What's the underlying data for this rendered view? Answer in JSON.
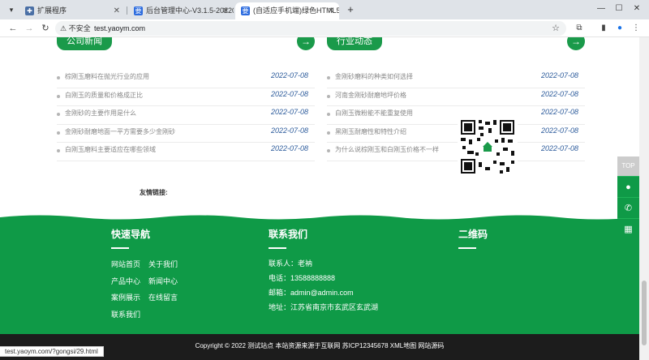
{
  "browser": {
    "tabs": [
      {
        "label": "扩展程序",
        "favicon": "puzzle-icon",
        "active": false
      },
      {
        "label": "后台管理中心-V3.1.5-2022070",
        "favicon": "yao-icon",
        "active": false
      },
      {
        "label": "(自适应手机端)绿色HTML5响应",
        "favicon": "yao-icon",
        "active": true
      }
    ],
    "new_tab": "+",
    "address": {
      "security": "不安全",
      "url": "test.yaoym.com"
    },
    "status_url": "test.yaoym.com/?gongsi/29.html"
  },
  "news": {
    "company": {
      "title": "公司新闻",
      "items": [
        {
          "text": "棕刚玉磨料在抛光行业的应用",
          "date": "2022-07-08"
        },
        {
          "text": "白刚玉的质量和价格成正比",
          "date": "2022-07-08"
        },
        {
          "text": "金刚砂的主要作用是什么",
          "date": "2022-07-08"
        },
        {
          "text": "金刚砂耐磨地面一平方需要多少金刚砂",
          "date": "2022-07-08"
        },
        {
          "text": "白刚玉磨料主要适应在哪些领域",
          "date": "2022-07-08"
        }
      ]
    },
    "industry": {
      "title": "行业动态",
      "items": [
        {
          "text": "金刚砂磨料的种类如何选择",
          "date": "2022-07-08"
        },
        {
          "text": "河南金刚砂耐磨地坪价格",
          "date": "2022-07-08"
        },
        {
          "text": "白刚玉微粉能不能重复使用",
          "date": "2022-07-08"
        },
        {
          "text": "黑刚玉耐磨性和特性介绍",
          "date": "2022-07-08"
        },
        {
          "text": "为什么说棕刚玉和白刚玉价格不一样",
          "date": "2022-07-08"
        }
      ]
    }
  },
  "links_label": "友情链接:",
  "footer": {
    "nav": {
      "title": "快速导航",
      "items": [
        "网站首页",
        "关于我们",
        "产品中心",
        "新闻中心",
        "案例展示",
        "在线留言",
        "联系我们"
      ]
    },
    "contact": {
      "title": "联系我们",
      "lines": [
        "联系人：老衲",
        "电话：13588888888",
        "邮箱：admin@admin.com",
        "地址：江苏省南京市玄武区玄武湖"
      ]
    },
    "qr": {
      "title": "二维码"
    }
  },
  "copyright": "Copyright © 2022 测试站点 本站资源来源于互联网 苏ICP12345678 XML地图 网站源码",
  "side": {
    "top": "TOP"
  },
  "colors": {
    "brand_green": "#0f9a47",
    "date_blue": "#2e5c9c"
  }
}
